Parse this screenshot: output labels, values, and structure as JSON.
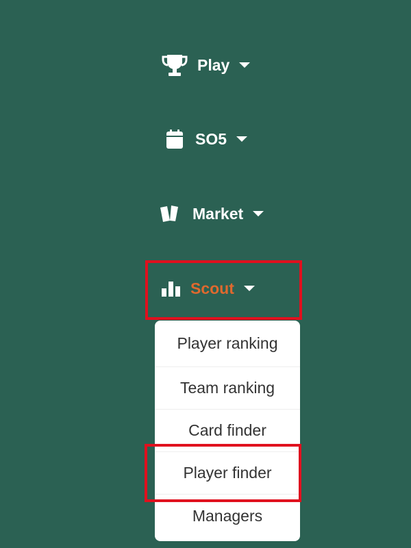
{
  "nav": {
    "items": [
      {
        "label": "Play",
        "icon": "trophy-icon"
      },
      {
        "label": "SO5",
        "icon": "calendar-icon"
      },
      {
        "label": "Market",
        "icon": "cards-icon"
      },
      {
        "label": "Scout",
        "icon": "bar-chart-icon",
        "active": true
      }
    ]
  },
  "scout_menu": {
    "items": [
      {
        "label": "Player ranking"
      },
      {
        "label": "Team ranking"
      },
      {
        "label": "Card finder"
      },
      {
        "label": "Player finder",
        "highlighted": true
      },
      {
        "label": "Managers"
      }
    ]
  },
  "colors": {
    "background": "#2b6153",
    "active_accent": "#e0692e",
    "highlight_border": "#e0101e",
    "menu_background": "#ffffff",
    "menu_text": "#333333"
  }
}
